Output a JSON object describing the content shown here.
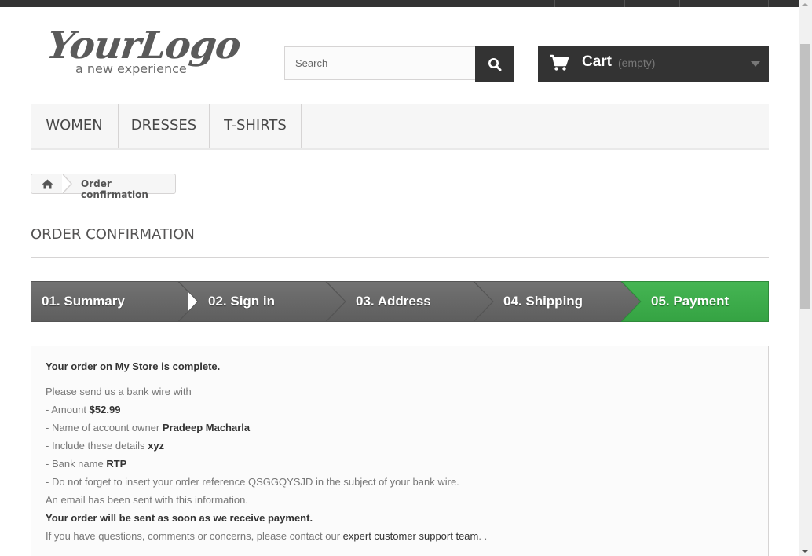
{
  "logo": {
    "script": "YourLogo",
    "tagline": "a new experience"
  },
  "search": {
    "placeholder": "Search",
    "icon": "search-icon"
  },
  "cart": {
    "label": "Cart",
    "status": "(empty)",
    "icon": "shopping-cart-icon"
  },
  "menu": {
    "items": [
      {
        "label": "Women"
      },
      {
        "label": "Dresses"
      },
      {
        "label": "T-shirts"
      }
    ]
  },
  "breadcrumb": {
    "home_icon": "home-icon",
    "current": "Order confirmation"
  },
  "page": {
    "title": "Order confirmation"
  },
  "steps": [
    {
      "label": "01. Summary",
      "state": "done"
    },
    {
      "label": "02. Sign in",
      "state": "done"
    },
    {
      "label": "03. Address",
      "state": "done"
    },
    {
      "label": "04. Shipping",
      "state": "done"
    },
    {
      "label": "05. Payment",
      "state": "current"
    }
  ],
  "confirmation": {
    "complete_prefix": "Your order on",
    "store_name": "My Store",
    "complete_suffix": "is complete.",
    "bank_wire_intro": "Please send us a bank wire with",
    "amount_label": "- Amount",
    "amount_value": "$52.99",
    "owner_label": "- Name of account owner",
    "owner_value": "Pradeep Macharla",
    "details_label": "- Include these details",
    "details_value": "xyz",
    "bank_label": "- Bank name",
    "bank_value": "RTP",
    "reference_prefix": "- Do not forget to insert your order reference",
    "reference_value": "QSGGQYSJD",
    "reference_suffix": "in the subject of your bank wire.",
    "email_sent": "An email has been sent with this information.",
    "ship_notice": "Your order will be sent as soon as we receive payment.",
    "contact_prefix": "If you have questions, comments or concerns, please contact our",
    "contact_link": "expert customer support team",
    "contact_suffix": ". ."
  },
  "colors": {
    "dark": "#333333",
    "step_gray": "#6f6f6f",
    "step_green": "#3aa04a",
    "border": "#d6d4d4"
  }
}
